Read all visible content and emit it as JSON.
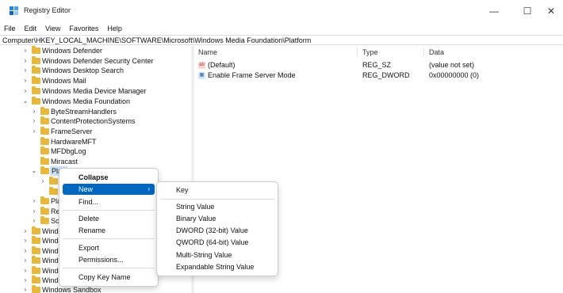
{
  "window": {
    "title": "Registry Editor",
    "controls": {
      "minimize": "—",
      "maximize": "☐",
      "close": "✕"
    }
  },
  "menu": [
    "File",
    "Edit",
    "View",
    "Favorites",
    "Help"
  ],
  "address": "Computer\\HKEY_LOCAL_MACHINE\\SOFTWARE\\Microsoft\\Windows Media Foundation\\Platform",
  "tree": {
    "rows": [
      {
        "label": "Windows Defender",
        "chevron": ">"
      },
      {
        "label": "Windows Defender Security Center",
        "chevron": ">"
      },
      {
        "label": "Windows Desktop Search",
        "chevron": ">"
      },
      {
        "label": "Windows Mail",
        "chevron": ">"
      },
      {
        "label": "Windows Media Device Manager",
        "chevron": ">"
      },
      {
        "label": "Windows Media Foundation",
        "chevron": "v"
      },
      {
        "label": "ByteStreamHandlers",
        "chevron": ">"
      },
      {
        "label": "ContentProtectionSystems",
        "chevron": ">"
      },
      {
        "label": "FrameServer",
        "chevron": ">"
      },
      {
        "label": "HardwareMFT",
        "chevron": ""
      },
      {
        "label": "MFDbgLog",
        "chevron": ""
      },
      {
        "label": "Miracast",
        "chevron": ""
      },
      {
        "label": "Platf",
        "chevron": "v"
      },
      {
        "label": "",
        "chevron": ">"
      },
      {
        "label": "",
        "chevron": ""
      },
      {
        "label": "Pla",
        "chevron": ">"
      },
      {
        "label": "Re",
        "chevron": ">"
      },
      {
        "label": "Sch",
        "chevron": ">"
      },
      {
        "label": "Windo",
        "chevron": ">"
      },
      {
        "label": "Windo",
        "chevron": ">"
      },
      {
        "label": "Windo",
        "chevron": ">"
      },
      {
        "label": "Windo",
        "chevron": ">"
      },
      {
        "label": "Windo",
        "chevron": ">"
      },
      {
        "label": "Windo",
        "chevron": ">"
      },
      {
        "label": "Windows Sandbox",
        "chevron": ">"
      }
    ]
  },
  "list": {
    "headers": {
      "name": "Name",
      "type": "Type",
      "data": "Data"
    },
    "rows": [
      {
        "name": "(Default)",
        "type": "REG_SZ",
        "data": "(value not set)",
        "icon": "string-value-icon",
        "icon_glyph": "ab"
      },
      {
        "name": "Enable Frame Server Mode",
        "type": "REG_DWORD",
        "data": "0x00000000 (0)",
        "icon": "binary-value-icon",
        "icon_glyph": "▦"
      }
    ]
  },
  "context_menu": {
    "items": [
      "Collapse",
      "New",
      "Find...",
      "Delete",
      "Rename",
      "Export",
      "Permissions...",
      "Copy Key Name"
    ],
    "submenu_arrow": "›"
  },
  "submenu": {
    "items": [
      "Key",
      "String Value",
      "Binary Value",
      "DWORD (32-bit) Value",
      "QWORD (64-bit) Value",
      "Multi-String Value",
      "Expandable String Value"
    ]
  },
  "colors": {
    "accent": "#0067c0",
    "folder": "#e8b83a",
    "selection": "#cce4f7"
  }
}
